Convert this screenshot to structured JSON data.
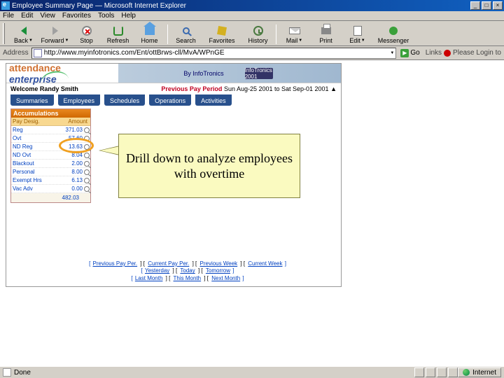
{
  "window": {
    "title": "Employee Summary Page — Microsoft Internet Explorer",
    "min": "_",
    "max": "□",
    "close": "×"
  },
  "menu": {
    "file": "File",
    "edit": "Edit",
    "view": "View",
    "favorites": "Favorites",
    "tools": "Tools",
    "help": "Help"
  },
  "toolbar": {
    "back": "Back",
    "forward": "Forward",
    "stop": "Stop",
    "refresh": "Refresh",
    "home": "Home",
    "search": "Search",
    "favorites": "Favorites",
    "history": "History",
    "mail": "Mail",
    "print": "Print",
    "edit": "Edit",
    "messenger": "Messenger"
  },
  "address": {
    "label": "Address",
    "url": "http://www.myinfotronics.com/Ent/ottBrws-cll/MvA/WPnGE",
    "go": "Go",
    "links": "Links",
    "login_prompt": "Please Login to"
  },
  "app": {
    "logo_a": "attendance",
    "logo_b": "enterprise",
    "brand_by": "By InfoTronics",
    "brand_badge": "InfoTronics 2001"
  },
  "welcome": {
    "text": "Welcome Randy Smith",
    "pp_label": "Previous Pay Period",
    "pp_range": "Sun Aug-25 2001 to Sat Sep-01 2001",
    "up_icon": "▲"
  },
  "tabs": {
    "summaries": "Summaries",
    "employees": "Employees",
    "schedules": "Schedules",
    "operations": "Operations",
    "activities": "Activities"
  },
  "accum": {
    "header": "Accumulations",
    "col1": "Pay Desig.",
    "col2": "Amount",
    "rows": [
      {
        "label": "Reg",
        "value": "371.03"
      },
      {
        "label": "Ovt",
        "value": "57.60"
      },
      {
        "label": "ND Reg",
        "value": "13.63"
      },
      {
        "label": "ND Ovt",
        "value": "8.04"
      },
      {
        "label": "Blackout",
        "value": "2.00"
      },
      {
        "label": "Personal",
        "value": "8.00"
      },
      {
        "label": "Exempt Hrs",
        "value": "6.13"
      },
      {
        "label": "Vac Adv",
        "value": "0.00"
      }
    ],
    "total": "482.03"
  },
  "callout": {
    "text": "Drill down to analyze employees with overtime"
  },
  "footer_links": {
    "row1": [
      "Previous Pay Per.",
      "Current Pay Per.",
      "Previous Week",
      "Current Week"
    ],
    "row2": [
      "Yesterday",
      "Today",
      "Tomorrow"
    ],
    "row3": [
      "Last Month",
      "This Month",
      "Next Month"
    ]
  },
  "status": {
    "done": "Done",
    "zone": "Internet"
  }
}
